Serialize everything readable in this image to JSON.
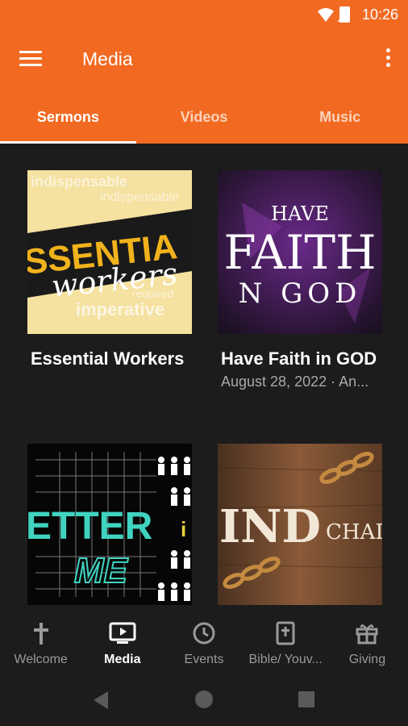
{
  "status_bar": {
    "time": "10:26"
  },
  "app_bar": {
    "title": "Media",
    "menu_icon": "hamburger-menu-icon",
    "more_icon": "more-vertical-icon"
  },
  "tabs": [
    {
      "label": "Sermons",
      "active": true
    },
    {
      "label": "Videos",
      "active": false
    },
    {
      "label": "Music",
      "active": false
    }
  ],
  "cards": [
    {
      "title": "Essential Workers",
      "subtitle": "",
      "thumb_words": [
        "SSENTIA",
        "workers",
        "imperative",
        "indispensable",
        "required"
      ]
    },
    {
      "title": "Have Faith in GOD",
      "subtitle": "August 28, 2022 · An...",
      "thumb_words": [
        "HAVE",
        "FAITH",
        "N GOD"
      ]
    },
    {
      "title": "",
      "subtitle": "",
      "thumb_words": [
        "ETTER",
        "ME"
      ]
    },
    {
      "title": "",
      "subtitle": "",
      "thumb_words": [
        "IND",
        "CHAI"
      ]
    }
  ],
  "bottom_nav": [
    {
      "label": "Welcome",
      "icon": "cross-icon",
      "active": false
    },
    {
      "label": "Media",
      "icon": "tv-play-icon",
      "active": true
    },
    {
      "label": "Events",
      "icon": "clock-icon",
      "active": false
    },
    {
      "label": "Bible/ Youv...",
      "icon": "bible-icon",
      "active": false
    },
    {
      "label": "Giving",
      "icon": "gift-icon",
      "active": false
    }
  ],
  "colors": {
    "brand": "#f26a22",
    "background": "#1c1c1c",
    "text": "#ffffff",
    "muted": "#a9a9a9"
  }
}
